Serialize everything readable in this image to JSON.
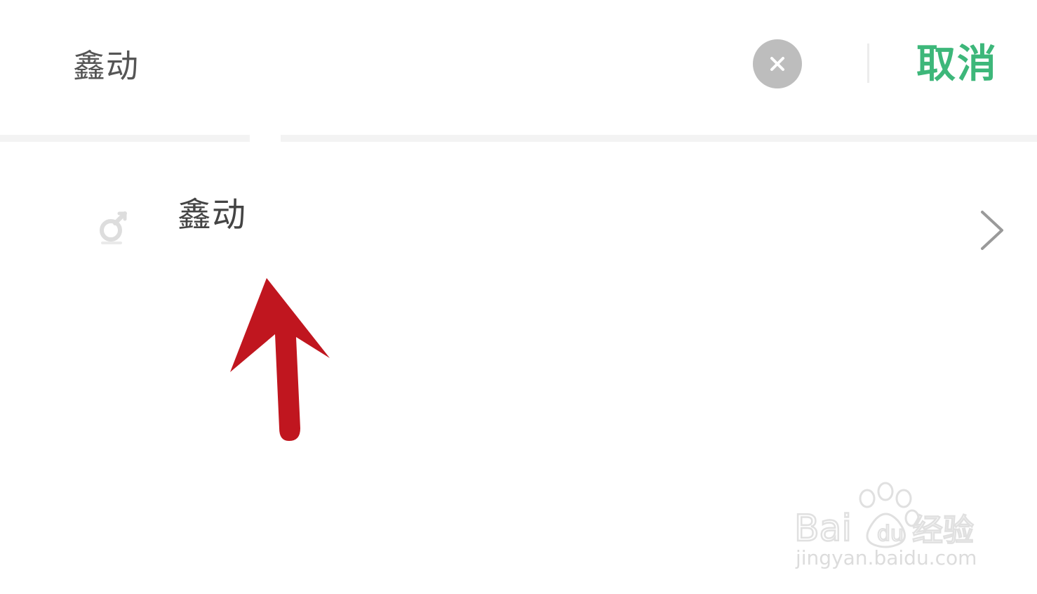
{
  "search": {
    "query": "鑫动",
    "cancel_label": "取消"
  },
  "results": [
    {
      "label": "鑫动",
      "icon": "contact-icon"
    }
  ],
  "annotation": {
    "icon": "red-arrow-up",
    "color": "#c0161f"
  },
  "colors": {
    "accent": "#3db77a",
    "clear_button": "#bdbdbd",
    "text_primary": "#444444",
    "watermark": "#dcdcdc"
  },
  "watermark": {
    "brand": "Baidu经验",
    "domain": "jingyan.baidu.com"
  }
}
